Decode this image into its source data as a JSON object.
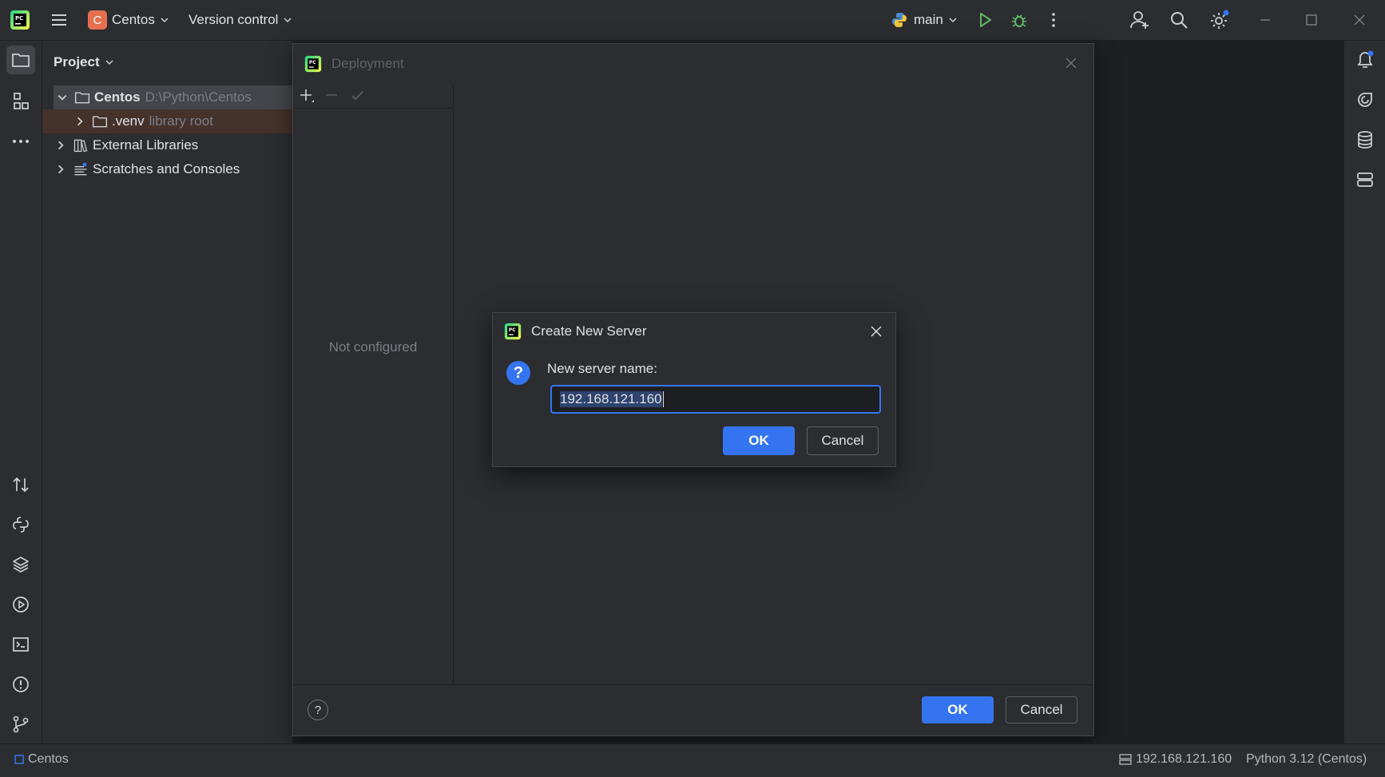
{
  "titlebar": {
    "project_badge": "C",
    "project_name": "Centos",
    "vcs_label": "Version control",
    "run_config": "main",
    "badge_color": "#e5704f",
    "accent": "#3574f0"
  },
  "project_panel": {
    "title": "Project",
    "tree": [
      {
        "label": "Centos",
        "detail": "D:\\Python\\Centos"
      },
      {
        "label": ".venv",
        "detail": "library root"
      },
      {
        "label": "External Libraries"
      },
      {
        "label": "Scratches and Consoles"
      }
    ]
  },
  "deployment_dialog": {
    "title": "Deployment",
    "empty_text": "Not configured",
    "ok_label": "OK",
    "cancel_label": "Cancel",
    "help_label": "?"
  },
  "create_server_dialog": {
    "title": "Create New Server",
    "prompt": "New server name:",
    "value": "192.168.121.160",
    "ok_label": "OK",
    "cancel_label": "Cancel",
    "question_glyph": "?"
  },
  "statusbar": {
    "breadcrumb": "Centos",
    "server": "192.168.121.160",
    "interpreter": "Python 3.12 (Centos)"
  },
  "icons": {
    "left_strip": [
      "folder-icon",
      "structure-icon",
      "more-icon",
      "commit-icon",
      "python-console-icon",
      "layers-icon",
      "services-icon",
      "terminal-icon",
      "problems-icon",
      "git-icon"
    ],
    "right_strip": [
      "notifications-icon",
      "ai-assistant-icon",
      "database-icon",
      "remote-host-icon"
    ]
  }
}
